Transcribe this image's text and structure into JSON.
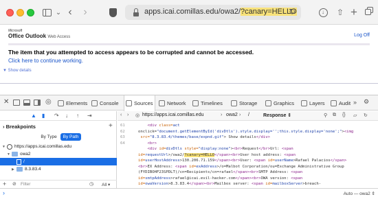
{
  "browser": {
    "url_prefix": "apps.icai.comillas.edu/owa2/",
    "url_highlight": "?canary=HELLO",
    "colors": {
      "accent": "#1a6ee5",
      "highlight": "#f8e27a"
    }
  },
  "page": {
    "logo_ms": "Microsoft",
    "logo_office": "Office Outlook",
    "logo_wa": "Web Access",
    "logoff": "Log Off",
    "error_title": "The item that you attempted to access appears to be corrupted and cannot be accessed.",
    "error_link": "Click here to continue working.",
    "show_details": "Show details"
  },
  "devtools": {
    "tabs": [
      "Elements",
      "Console",
      "Sources",
      "Network",
      "Timelines",
      "Storage",
      "Graphics",
      "Layers",
      "Audit"
    ],
    "active_tab": "Sources",
    "breakpoints_label": "Breakpoints",
    "seg_by_type": "By Type",
    "seg_by_path": "By Path",
    "tree": {
      "origin": "https://apps.icai.comillas.edu",
      "folder": "owa2",
      "file": "/",
      "child": "8.3.83.4"
    },
    "filter_placeholder": "Filter",
    "filter_all": "All",
    "editor": {
      "crumb_url": "https://apps.icai.comillas.edu",
      "crumb_folder": "owa2",
      "crumb_file": "/",
      "response": "Response"
    },
    "gutter": [
      "61",
      "62",
      "",
      "63",
      "64",
      "",
      "",
      "",
      "",
      "",
      ""
    ],
    "console_context": "Auto — owa2"
  }
}
